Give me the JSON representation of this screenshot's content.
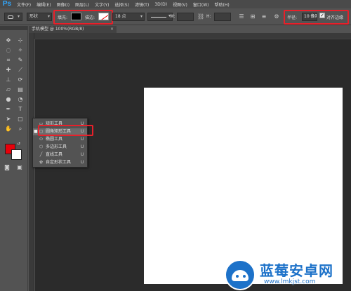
{
  "app": {
    "logo": "Ps"
  },
  "menu": [
    "文件(F)",
    "编辑(E)",
    "图像(I)",
    "图层(L)",
    "文字(Y)",
    "选择(S)",
    "滤镜(T)",
    "3D(D)",
    "视图(V)",
    "窗口(W)",
    "帮助(H)"
  ],
  "options": {
    "mode": "形状",
    "fill_label": "填充:",
    "stroke_label": "描边:",
    "stroke_width": "18 点",
    "w_label": "W:",
    "h_label": "H:",
    "radius_label": "半径:",
    "radius_value": "10 像素",
    "align_label": "对齐边缘",
    "fill_color": "#000000",
    "stroke_color": "none"
  },
  "document": {
    "tab_title": "手机模型 @ 100%(RGB/8)",
    "close_glyph": "×"
  },
  "tools": {
    "foreground_color": "#e8000a",
    "background_color": "#ffffff"
  },
  "flyout": {
    "items": [
      {
        "label": "矩形工具",
        "key": "U",
        "icon": "rectangle-icon",
        "glyph": "▭",
        "selected": false
      },
      {
        "label": "圆角矩形工具",
        "key": "U",
        "icon": "rounded-rectangle-icon",
        "glyph": "▢",
        "selected": true
      },
      {
        "label": "椭圆工具",
        "key": "U",
        "icon": "ellipse-icon",
        "glyph": "⬭",
        "selected": false
      },
      {
        "label": "多边形工具",
        "key": "U",
        "icon": "polygon-icon",
        "glyph": "⬡",
        "selected": false
      },
      {
        "label": "直线工具",
        "key": "U",
        "icon": "line-icon",
        "glyph": "╱",
        "selected": false
      },
      {
        "label": "自定形状工具",
        "key": "U",
        "icon": "custom-shape-icon",
        "glyph": "✿",
        "selected": false
      }
    ]
  },
  "watermark": {
    "title": "蓝莓安卓网",
    "url": "www.lmkjst.com"
  }
}
